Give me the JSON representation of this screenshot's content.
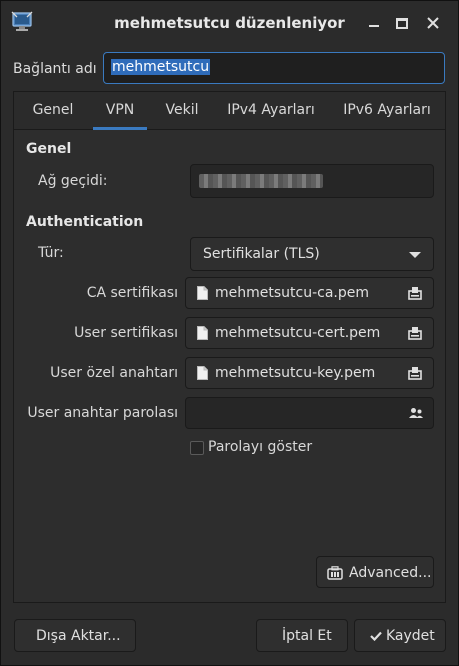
{
  "window": {
    "title": "mehmetsutcu düzenleniyor"
  },
  "connection": {
    "label": "Bağlantı adı",
    "value": "mehmetsutcu"
  },
  "tabs": [
    {
      "label": "Genel"
    },
    {
      "label": "VPN"
    },
    {
      "label": "Vekil"
    },
    {
      "label": "IPv4 Ayarları"
    },
    {
      "label": "IPv6 Ayarları"
    }
  ],
  "general": {
    "title": "Genel",
    "gateway_label": "Ağ geçidi:"
  },
  "auth": {
    "title": "Authentication",
    "type_label": "Tür:",
    "type_value": "Sertifikalar (TLS)",
    "ca_label": "CA sertifikası",
    "ca_value": "mehmetsutcu-ca.pem",
    "user_cert_label": "User sertifikası",
    "user_cert_value": "mehmetsutcu-cert.pem",
    "user_key_label": "User özel anahtarı",
    "user_key_value": "mehmetsutcu-key.pem",
    "key_pass_label": "User anahtar parolası",
    "show_pass_label": "Parolayı göster"
  },
  "buttons": {
    "advanced": "Advanced...",
    "export": "Dışa Aktar...",
    "cancel": "İptal Et",
    "save": "Kaydet"
  },
  "colors": {
    "accent": "#3a7ac0",
    "background": "#2b2b2b"
  }
}
